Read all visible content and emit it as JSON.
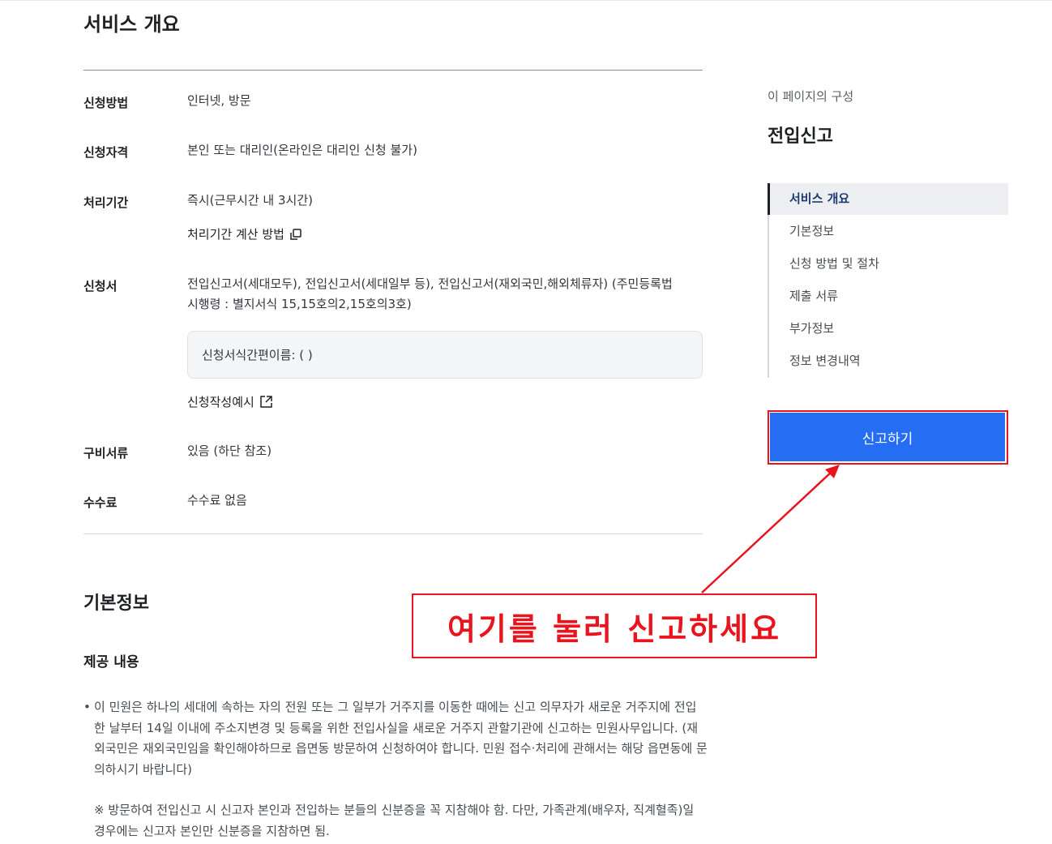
{
  "overview": {
    "title": "서비스 개요",
    "rows": {
      "method": {
        "label": "신청방법",
        "value": "인터넷, 방문"
      },
      "eligibility": {
        "label": "신청자격",
        "value": "본인 또는 대리인(온라인은 대리인 신청 불가)"
      },
      "period": {
        "label": "처리기간",
        "value": "즉시(근무시간 내 3시간)",
        "link": "처리기간 계산 방법"
      },
      "form": {
        "label": "신청서",
        "value_line1": "전입신고서(세대모두), 전입신고서(세대일부 등), 전입신고서(재외국민,해외체류자) (주민등록법",
        "value_line2": "시행령 : 별지서식 15,15호의2,15호의3호)",
        "box_text": "신청서식간편이름: ( )",
        "example_link": "신청작성예시"
      },
      "documents": {
        "label": "구비서류",
        "value": "있음 (하단 참조)"
      },
      "fee": {
        "label": "수수료",
        "value": "수수료 없음"
      }
    }
  },
  "basic_info": {
    "title": "기본정보",
    "subtitle": "제공 내용",
    "bullet": "•",
    "description": "이 민원은 하나의 세대에 속하는 자의 전원 또는 그 일부가 거주지를 이동한 때에는 신고 의무자가 새로운 거주지에 전입한 날부터 14일 이내에 주소지변경 및 등록을 위한 전입사실을 새로운 거주지 관할기관에 신고하는 민원사무입니다. (재외국민은 재외국민임을 확인해야하므로 읍면동 방문하여 신청하여야 합니다. 민원 접수·처리에 관해서는 해당 읍면동에 문의하시기 바랍니다)",
    "note": "※ 방문하여 전입신고 시 신고자 본인과 전입하는 분들의 신분증을 꼭 지참해야 함. 다만, 가족관계(배우자, 직계혈족)일 경우에는 신고자 본인만 신분증을 지참하면 됨."
  },
  "toc": {
    "caption": "이 페이지의 구성",
    "title": "전입신고",
    "items": [
      {
        "label": "서비스 개요",
        "active": true
      },
      {
        "label": "기본정보"
      },
      {
        "label": "신청 방법 및 절차"
      },
      {
        "label": "제출 서류"
      },
      {
        "label": "부가정보"
      },
      {
        "label": "정보 변경내역"
      }
    ]
  },
  "report_button": {
    "label": "신고하기",
    "color": "#256ef4"
  },
  "callout": {
    "text": "여기를 눌러 신고하세요",
    "color": "#e8141e"
  },
  "icons": {
    "copy": "copy-icon",
    "external": "external-link-icon"
  }
}
